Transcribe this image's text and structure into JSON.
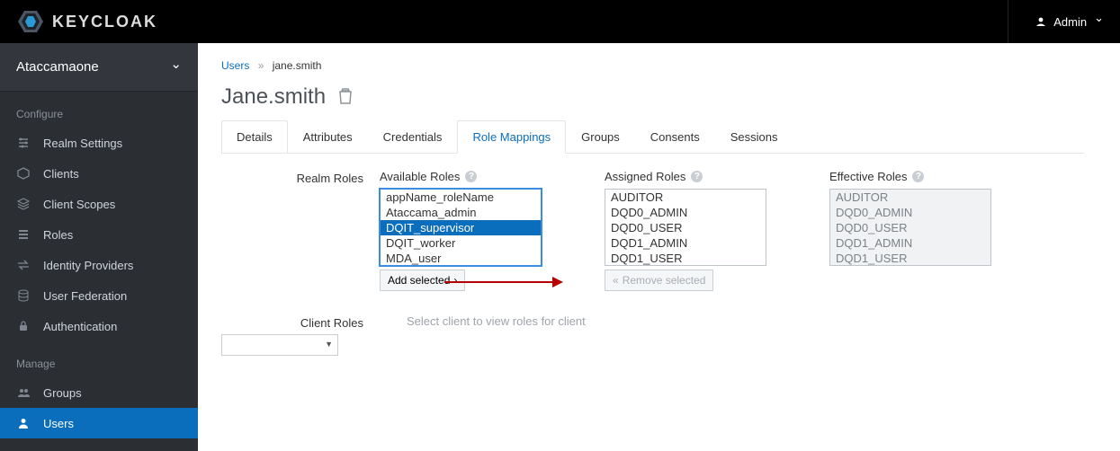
{
  "header": {
    "brand": "KEYCLOAK",
    "user_label": "Admin"
  },
  "sidebar": {
    "realm_name": "Ataccamaone",
    "section_configure": "Configure",
    "section_manage": "Manage",
    "items_configure": [
      {
        "label": "Realm Settings",
        "icon": "sliders-icon"
      },
      {
        "label": "Clients",
        "icon": "cube-icon"
      },
      {
        "label": "Client Scopes",
        "icon": "stack-icon"
      },
      {
        "label": "Roles",
        "icon": "list-icon"
      },
      {
        "label": "Identity Providers",
        "icon": "exchange-icon"
      },
      {
        "label": "User Federation",
        "icon": "database-icon"
      },
      {
        "label": "Authentication",
        "icon": "lock-icon"
      }
    ],
    "items_manage": [
      {
        "label": "Groups",
        "icon": "group-icon",
        "active": false
      },
      {
        "label": "Users",
        "icon": "user-icon",
        "active": true
      }
    ]
  },
  "breadcrumb": {
    "parent": "Users",
    "current": "jane.smith"
  },
  "page": {
    "title": "Jane.smith"
  },
  "tabs": [
    {
      "label": "Details"
    },
    {
      "label": "Attributes"
    },
    {
      "label": "Credentials"
    },
    {
      "label": "Role Mappings",
      "active": true
    },
    {
      "label": "Groups"
    },
    {
      "label": "Consents"
    },
    {
      "label": "Sessions"
    }
  ],
  "roles": {
    "row_label": "Realm Roles",
    "available_title": "Available Roles",
    "assigned_title": "Assigned Roles",
    "effective_title": "Effective Roles",
    "available": [
      {
        "label": "appName_roleName"
      },
      {
        "label": "Ataccama_admin"
      },
      {
        "label": "DQIT_supervisor",
        "selected": true
      },
      {
        "label": "DQIT_worker"
      },
      {
        "label": "MDA_user"
      }
    ],
    "assigned": [
      {
        "label": "AUDITOR"
      },
      {
        "label": "DQD0_ADMIN"
      },
      {
        "label": "DQD0_USER"
      },
      {
        "label": "DQD1_ADMIN"
      },
      {
        "label": "DQD1_USER"
      }
    ],
    "effective": [
      {
        "label": "AUDITOR"
      },
      {
        "label": "DQD0_ADMIN"
      },
      {
        "label": "DQD0_USER"
      },
      {
        "label": "DQD1_ADMIN"
      },
      {
        "label": "DQD1_USER"
      }
    ],
    "add_button": "Add selected",
    "remove_button": "Remove selected"
  },
  "client_roles": {
    "row_label": "Client Roles",
    "hint": "Select client to view roles for client"
  }
}
